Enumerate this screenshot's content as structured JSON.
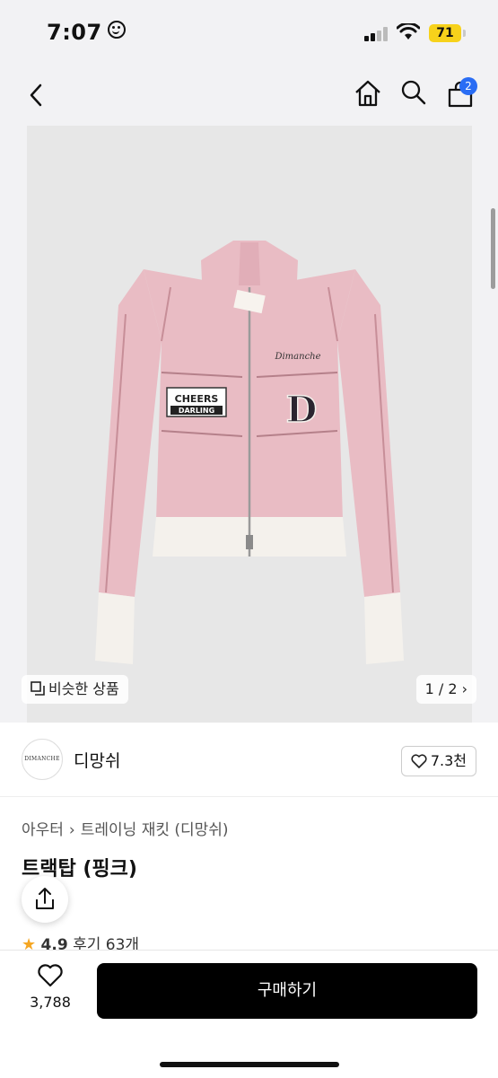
{
  "status": {
    "time": "7:07",
    "battery": "71"
  },
  "nav": {
    "cart_count": "2"
  },
  "photo": {
    "patch_line1": "CHEERS",
    "patch_line2": "DARLING",
    "letter": "D",
    "script": "Dimanche",
    "similar_label": "비슷한 상품",
    "pager": "1 / 2"
  },
  "shop": {
    "logo_text": "DIMANCHE",
    "name": "디망쉬",
    "likes": "7.3천"
  },
  "product": {
    "breadcrumb": [
      "아우터",
      "트레이닝 재킷 (디망쉬)"
    ],
    "title": "트랙탑 (핑크)",
    "rating": "4.9",
    "reviews": "후기 63개"
  },
  "bottom": {
    "wish_count": "3,788",
    "buy_label": "구매하기"
  },
  "colors": {
    "accent": "#2a6df4",
    "jacket": "#e9bcc4",
    "buy": "#000000"
  }
}
